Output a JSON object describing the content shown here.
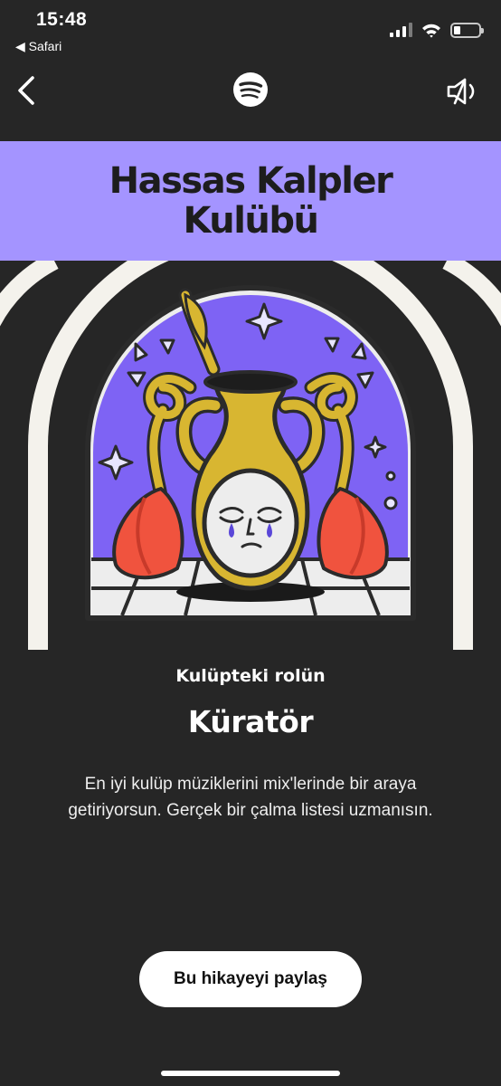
{
  "status_bar": {
    "time": "15:48",
    "back_app": "◀ Safari",
    "icons": [
      "cellular-signal-icon",
      "wifi-icon",
      "battery-icon"
    ]
  },
  "nav": {
    "back_icon": "chevron-left-icon",
    "logo_icon": "spotify-logo-icon",
    "mute_icon": "speaker-muted-icon"
  },
  "story": {
    "title": "Hassas Kalpler Kulübü",
    "role_label": "Kulüpteki rolün",
    "role_name": "Küratör",
    "role_description": "En iyi kulüp müziklerini mix'lerinde bir araya getiriyorsun. Gerçek bir çalma listesi uzmanısın.",
    "share_label": "Bu hikayeyi paylaş"
  },
  "colors": {
    "background": "#262626",
    "banner": "#a494ff",
    "art_purple": "#7e63f4",
    "art_yellow": "#d8b631",
    "art_red": "#f0533e"
  }
}
